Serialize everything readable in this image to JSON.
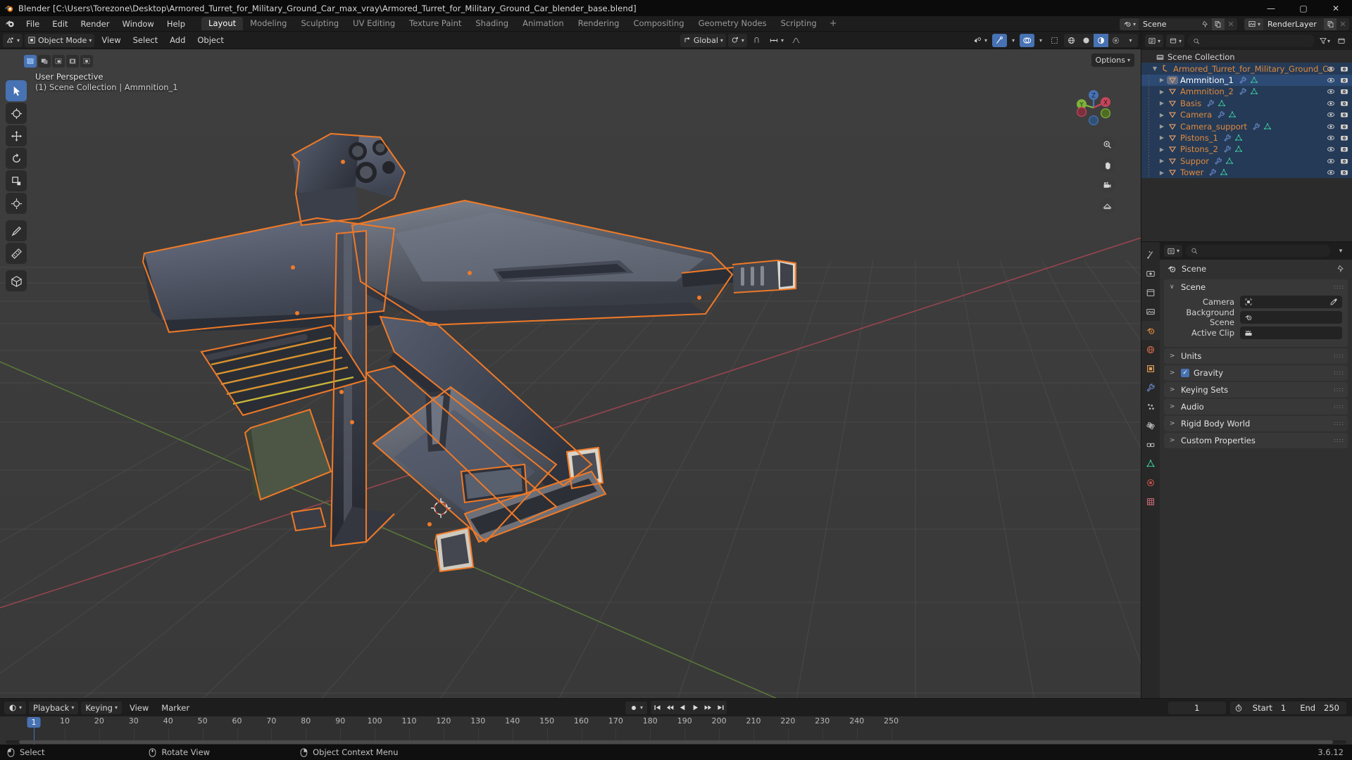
{
  "window": {
    "title": "Blender [C:\\Users\\Torezone\\Desktop\\Armored_Turret_for_Military_Ground_Car_max_vray\\Armored_Turret_for_Military_Ground_Car_blender_base.blend]",
    "minimize": "—",
    "maximize": "▢",
    "close": "✕"
  },
  "menu": {
    "items": [
      "File",
      "Edit",
      "Render",
      "Window",
      "Help"
    ]
  },
  "workspace_tabs": [
    {
      "label": "Layout",
      "active": true
    },
    {
      "label": "Modeling",
      "active": false
    },
    {
      "label": "Sculpting",
      "active": false
    },
    {
      "label": "UV Editing",
      "active": false
    },
    {
      "label": "Texture Paint",
      "active": false
    },
    {
      "label": "Shading",
      "active": false
    },
    {
      "label": "Animation",
      "active": false
    },
    {
      "label": "Rendering",
      "active": false
    },
    {
      "label": "Compositing",
      "active": false
    },
    {
      "label": "Geometry Nodes",
      "active": false
    },
    {
      "label": "Scripting",
      "active": false
    },
    {
      "label": "+",
      "active": false
    }
  ],
  "topbar_right": {
    "scene_name": "Scene",
    "viewlayer_name": "RenderLayer"
  },
  "viewport_header": {
    "mode": "Object Mode",
    "menus": [
      "View",
      "Select",
      "Add",
      "Object"
    ],
    "transform_orientation": "Global",
    "options_label": "Options"
  },
  "viewport_overlay": {
    "perspective": "User Perspective",
    "collection_line": "(1) Scene Collection | Ammnition_1",
    "gizmo_axes": {
      "x": "X",
      "y": "Y",
      "z": "Z"
    }
  },
  "outliner": {
    "search_placeholder": "",
    "root": "Scene Collection",
    "collection": {
      "label": "Armored_Turret_for_Military_Ground_Ca",
      "expanded": true
    },
    "objects": [
      {
        "label": "Ammnition_1",
        "selected": true,
        "active": true
      },
      {
        "label": "Ammnition_2",
        "selected": false,
        "active": false
      },
      {
        "label": "Basis",
        "selected": false,
        "active": false
      },
      {
        "label": "Camera",
        "selected": false,
        "active": false
      },
      {
        "label": "Camera_support",
        "selected": false,
        "active": false
      },
      {
        "label": "Pistons_1",
        "selected": false,
        "active": false
      },
      {
        "label": "Pistons_2",
        "selected": false,
        "active": false
      },
      {
        "label": "Suppor",
        "selected": false,
        "active": false
      },
      {
        "label": "Tower",
        "selected": false,
        "active": false
      }
    ]
  },
  "properties": {
    "search_placeholder": "",
    "breadcrumb": "Scene",
    "panels": [
      {
        "label": "Scene",
        "open": true,
        "checkbox": false
      },
      {
        "label": "Units",
        "open": false,
        "checkbox": false
      },
      {
        "label": "Gravity",
        "open": false,
        "checkbox": true
      },
      {
        "label": "Keying Sets",
        "open": false,
        "checkbox": false
      },
      {
        "label": "Audio",
        "open": false,
        "checkbox": false
      },
      {
        "label": "Rigid Body World",
        "open": false,
        "checkbox": false
      },
      {
        "label": "Custom Properties",
        "open": false,
        "checkbox": false
      }
    ],
    "scene_fields": [
      {
        "label": "Camera",
        "value": "",
        "icon": "camera-icon",
        "eyedropper": true
      },
      {
        "label": "Background Scene",
        "value": "",
        "icon": "scene-icon",
        "eyedropper": false
      },
      {
        "label": "Active Clip",
        "value": "",
        "icon": "clip-icon",
        "eyedropper": false
      }
    ]
  },
  "timeline": {
    "buttons": [
      "Playback",
      "Keying"
    ],
    "menus": [
      "View",
      "Marker"
    ],
    "current_frame": "1",
    "start_label": "Start",
    "start_value": "1",
    "end_label": "End",
    "end_value": "250",
    "ticks": [
      {
        "label": "10",
        "frame": 10
      },
      {
        "label": "20",
        "frame": 20
      },
      {
        "label": "30",
        "frame": 30
      },
      {
        "label": "40",
        "frame": 40
      },
      {
        "label": "50",
        "frame": 50
      },
      {
        "label": "60",
        "frame": 60
      },
      {
        "label": "70",
        "frame": 70
      },
      {
        "label": "80",
        "frame": 80
      },
      {
        "label": "90",
        "frame": 90
      },
      {
        "label": "100",
        "frame": 100
      },
      {
        "label": "110",
        "frame": 110
      },
      {
        "label": "120",
        "frame": 120
      },
      {
        "label": "130",
        "frame": 130
      },
      {
        "label": "140",
        "frame": 140
      },
      {
        "label": "150",
        "frame": 150
      },
      {
        "label": "160",
        "frame": 160
      },
      {
        "label": "170",
        "frame": 170
      },
      {
        "label": "180",
        "frame": 180
      },
      {
        "label": "190",
        "frame": 190
      },
      {
        "label": "200",
        "frame": 200
      },
      {
        "label": "210",
        "frame": 210
      },
      {
        "label": "220",
        "frame": 220
      },
      {
        "label": "230",
        "frame": 230
      },
      {
        "label": "240",
        "frame": 240
      },
      {
        "label": "250",
        "frame": 250
      }
    ],
    "playhead_label": "1"
  },
  "statusbar": {
    "items": [
      {
        "label": "Select",
        "icon": "mouse-left-icon"
      },
      {
        "label": "Rotate View",
        "icon": "mouse-middle-icon"
      },
      {
        "label": "Object Context Menu",
        "icon": "mouse-right-icon"
      }
    ],
    "version": "3.6.12"
  },
  "colors": {
    "accent_blue": "#4772b3",
    "selected_orange": "#f07a28",
    "object_text": "#e08a3c",
    "panel_bg": "#303030",
    "header_bg": "#1d1d1d",
    "viewport_bg": "#3b3b3b"
  }
}
